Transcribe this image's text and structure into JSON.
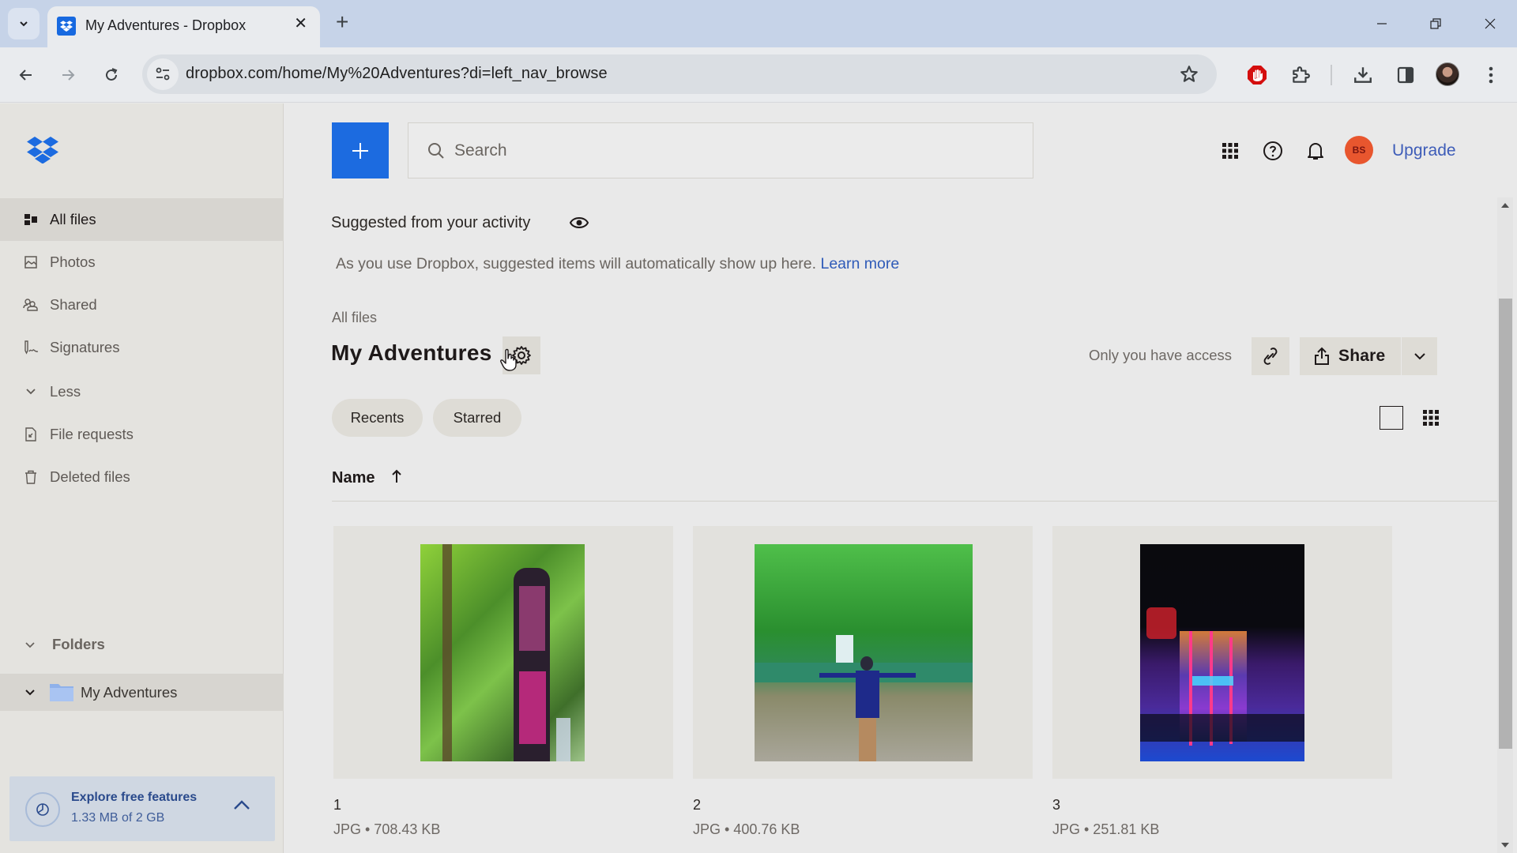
{
  "browser": {
    "tab_title": "My Adventures - Dropbox",
    "url": "dropbox.com/home/My%20Adventures?di=left_nav_browse",
    "icons": [
      "tab-list-icon",
      "dropbox-favicon",
      "close-icon",
      "new-tab-icon",
      "minimize-icon",
      "restore-icon",
      "window-close-icon",
      "back-icon",
      "forward-icon",
      "reload-icon",
      "site-info-icon",
      "bookmark-star-icon",
      "adblock-icon",
      "extensions-icon",
      "downloads-icon",
      "side-panel-icon",
      "profile-avatar",
      "menu-icon"
    ]
  },
  "sidebar": {
    "items": [
      {
        "label": "All files",
        "icon": "all-files-icon",
        "active": true
      },
      {
        "label": "Photos",
        "icon": "photos-icon",
        "active": false
      },
      {
        "label": "Shared",
        "icon": "shared-icon",
        "active": false
      },
      {
        "label": "Signatures",
        "icon": "signatures-icon",
        "active": false
      },
      {
        "label": "Less",
        "icon": "chevron-down-icon",
        "active": false
      },
      {
        "label": "File requests",
        "icon": "file-requests-icon",
        "active": false
      },
      {
        "label": "Deleted files",
        "icon": "trash-icon",
        "active": false
      }
    ],
    "folders_label": "Folders",
    "folder_tree": [
      {
        "label": "My Adventures",
        "expanded": true
      }
    ],
    "explore": {
      "title": "Explore free features",
      "usage": "1.33 MB of 2 GB"
    }
  },
  "header": {
    "search_placeholder": "Search",
    "avatar_initials": "BS",
    "upgrade_label": "Upgrade"
  },
  "suggested": {
    "title": "Suggested from your activity",
    "subtitle": "As you use Dropbox, suggested items will automatically show up here.",
    "learn_more": "Learn more"
  },
  "folder": {
    "breadcrumb": "All files",
    "title": "My Adventures",
    "access_text": "Only you have access",
    "share_label": "Share"
  },
  "filters": {
    "chips": [
      "Recents",
      "Starred"
    ]
  },
  "list": {
    "sort_column": "Name",
    "sort_direction": "ascending",
    "files": [
      {
        "name": "1",
        "meta": "JPG • 708.43 KB",
        "thumbnail": "forest-trail-signpost"
      },
      {
        "name": "2",
        "meta": "JPG • 400.76 KB",
        "thumbnail": "waterfall-hiker"
      },
      {
        "name": "3",
        "meta": "JPG • 251.81 KB",
        "thumbnail": "citywalk-night"
      }
    ]
  },
  "colors": {
    "accent_blue": "#1c6be0",
    "avatar_orange": "#e8562e",
    "link_blue": "#3d5cb8"
  }
}
